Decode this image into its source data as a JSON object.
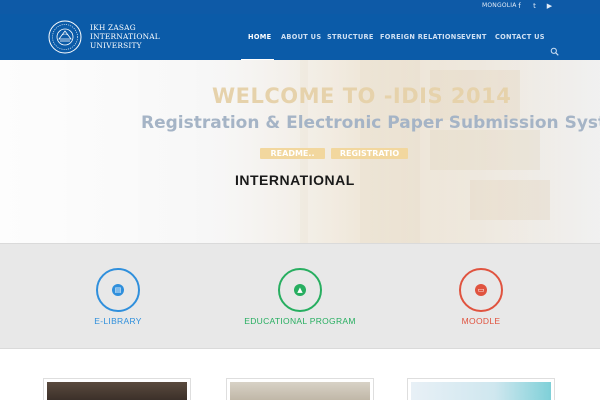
{
  "topbar": {
    "language": "MONGOLIA",
    "social": [
      {
        "name": "facebook",
        "glyph": "f"
      },
      {
        "name": "twitter",
        "glyph": "t"
      },
      {
        "name": "youtube",
        "glyph": "▶"
      }
    ]
  },
  "header": {
    "logo_lines": [
      "IKH ZASAG",
      "INTERNATIONAL",
      "UNIVERSITY"
    ],
    "nav": [
      {
        "label": "HOME",
        "active": true
      },
      {
        "label": "ABOUT US",
        "active": false
      },
      {
        "label": "STRUCTURE",
        "active": false
      },
      {
        "label": "FOREIGN RELATIONS",
        "active": false
      },
      {
        "label": "EVENT",
        "active": false
      },
      {
        "label": "CONTACT US",
        "active": false
      }
    ]
  },
  "hero": {
    "title": "WELCOME TO -IDIS 2014",
    "subtitle": "Registration & Electronic Paper Submission Syst",
    "buttons": [
      "README..",
      "REGISTRATIO"
    ],
    "caption": "INTERNATIONAL"
  },
  "features": [
    {
      "label": "E-LIBRARY",
      "icon": "book-icon",
      "color": "#2f8fdc"
    },
    {
      "label": "EDUCATIONAL PROGRAM",
      "icon": "graduation-cap-icon",
      "color": "#27ae60"
    },
    {
      "label": "MOODLE",
      "icon": "monitor-icon",
      "color": "#e0533f"
    }
  ],
  "colors": {
    "header_blue": "#0b5ba8",
    "topbar_blue": "#0e5aa7",
    "hero_title": "#e6d2ab",
    "hero_subtitle": "#a5b4c6",
    "button_gold": "#f2d79e"
  }
}
